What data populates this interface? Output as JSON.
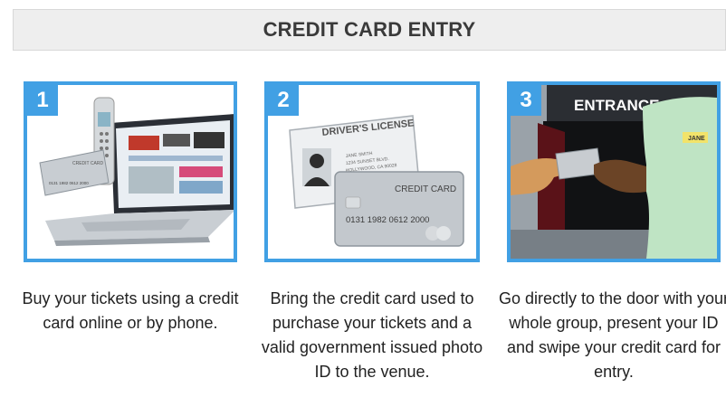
{
  "header": {
    "title": "CREDIT CARD ENTRY"
  },
  "steps": [
    {
      "number": "1",
      "card_label": "CREDIT CARD",
      "card_number": "0131 1982 0612 2000",
      "caption": "Buy your tickets using a credit card online or by phone.",
      "icons": [
        "laptop-icon",
        "cordless-phone-icon",
        "credit-card-icon"
      ]
    },
    {
      "number": "2",
      "license_title": "DRIVER'S LICENSE",
      "license_lines": [
        "JANE SMITH",
        "1234 SUNSET BLVD.",
        "HOLLYWOOD, CA 90028"
      ],
      "card_label": "CREDIT CARD",
      "card_number": "0131  1982  0612  2000",
      "caption": "Bring the credit card used to purchase your tickets and a valid government issued photo ID to the venue.",
      "icons": [
        "drivers-license-icon",
        "credit-card-icon"
      ]
    },
    {
      "number": "3",
      "entrance_sign": "ENTRANCE",
      "name_tag": "JANE",
      "caption": "Go directly to the door with your whole group, present your ID and swipe your credit card for entry.",
      "icons": [
        "entrance-door-icon",
        "hand-card-icon"
      ]
    }
  ],
  "colors": {
    "accent": "#41a0e4",
    "header_bg": "#eeeeee",
    "text": "#222222"
  }
}
